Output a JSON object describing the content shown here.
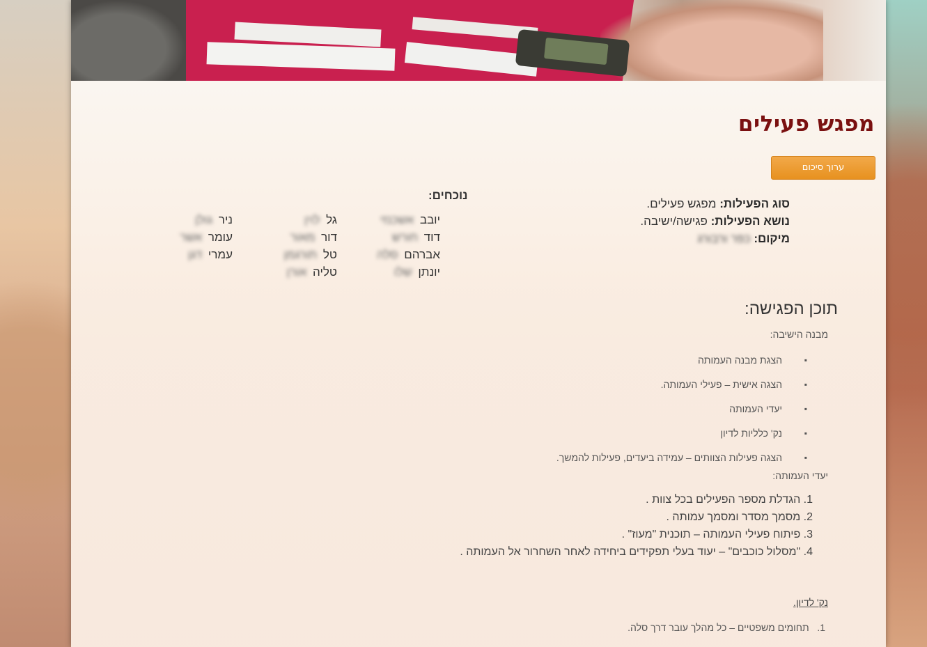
{
  "page": {
    "title": "מפגש פעילים",
    "edit_button": "ערוך סיכום"
  },
  "meta": {
    "type_label": "סוג הפעילות:",
    "type_value": "מפגש פעילים.",
    "topic_label": "נושא הפעילות:",
    "topic_value": "פגישה/ישיבה.",
    "location_label": "מיקום:",
    "location_value": "כפר ורבורג"
  },
  "attendees": {
    "title": "נוכחים:",
    "columns": [
      [
        {
          "first": "יובב",
          "last": "אשכנזי"
        },
        {
          "first": "דוד",
          "last": "חורש"
        },
        {
          "first": "אברהם",
          "last": "סלה"
        },
        {
          "first": "יונתן",
          "last": "שלו"
        }
      ],
      [
        {
          "first": "גל",
          "last": "לוין"
        },
        {
          "first": "דור",
          "last": "מאור"
        },
        {
          "first": "טל",
          "last": "תורגמן"
        },
        {
          "first": "טליה",
          "last": "אורן"
        }
      ],
      [
        {
          "first": "ניר",
          "last": "גולן"
        },
        {
          "first": "עומר",
          "last": "אשר"
        },
        {
          "first": "עמרי",
          "last": "דגן"
        }
      ]
    ]
  },
  "content": {
    "heading": "תוכן הפגישה:",
    "structure_label": "מבנה הישיבה:",
    "structure_items": [
      "הצגת מבנה העמותה",
      "הצגה אישית – פעילי העמותה.",
      "יעדי העמותה",
      "נק' כלליות לדיון",
      "הצגה פעילות הצוותים – עמידה ביעדים, פעילות להמשך."
    ],
    "goals_label": "יעדי העמותה:",
    "goals_items": [
      "הגדלת מספר הפעילים בכל צוות .",
      "מסמך מסדר ומסמך עמותה .",
      "פיתוח פעילי העמותה – תוכנית \"מעוז\" .",
      "\"מסלול כוכבים\" – יעוד בעלי תפקידים ביחידה לאחר השחרור אל העמותה ."
    ],
    "discussion_label": "נק' לדיון.",
    "discussion_items": [
      "תחומים משפטיים – כל מהלך עובר דרך סלה."
    ]
  }
}
